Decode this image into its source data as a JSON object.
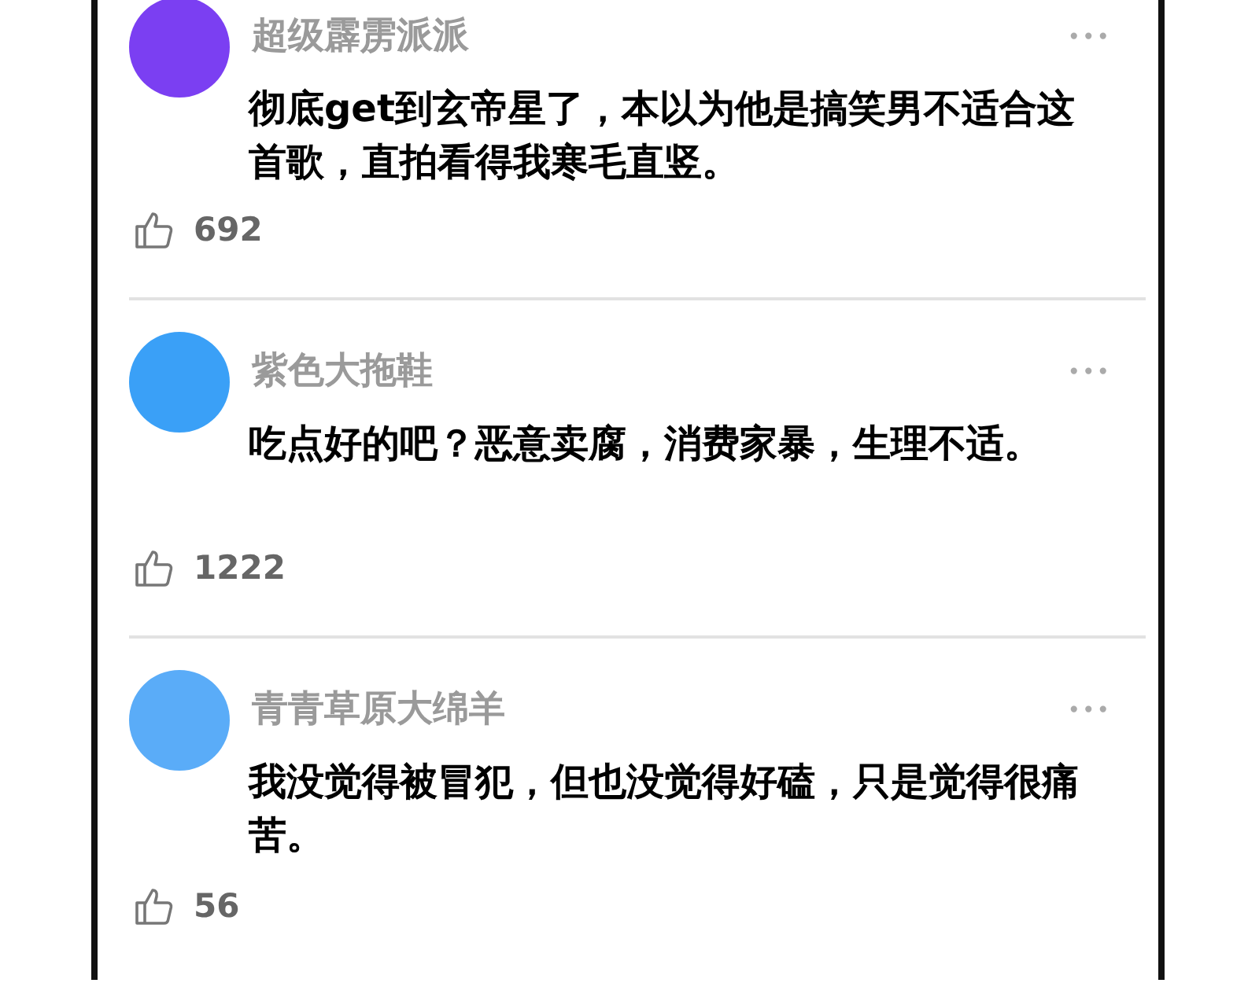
{
  "comments": [
    {
      "color": "#7b3ff2",
      "username": "超级霹雳派派",
      "menu": "•••",
      "text": "彻底get到玄帝星了，本以为他是搞笑男不适合这首歌，直拍看得我寒毛直竖。",
      "likes": "692"
    },
    {
      "color": "#3aa0f7",
      "username": "紫色大拖鞋",
      "menu": "•••",
      "text": "吃点好的吧？恶意卖腐，消费家暴，生理不适。",
      "likes": "1222"
    },
    {
      "color": "#5aacf8",
      "username": "青青草原大绵羊",
      "menu": "•••",
      "text": "我没觉得被冒犯，但也没觉得好磕，只是觉得很痛苦。",
      "likes": "56"
    }
  ]
}
